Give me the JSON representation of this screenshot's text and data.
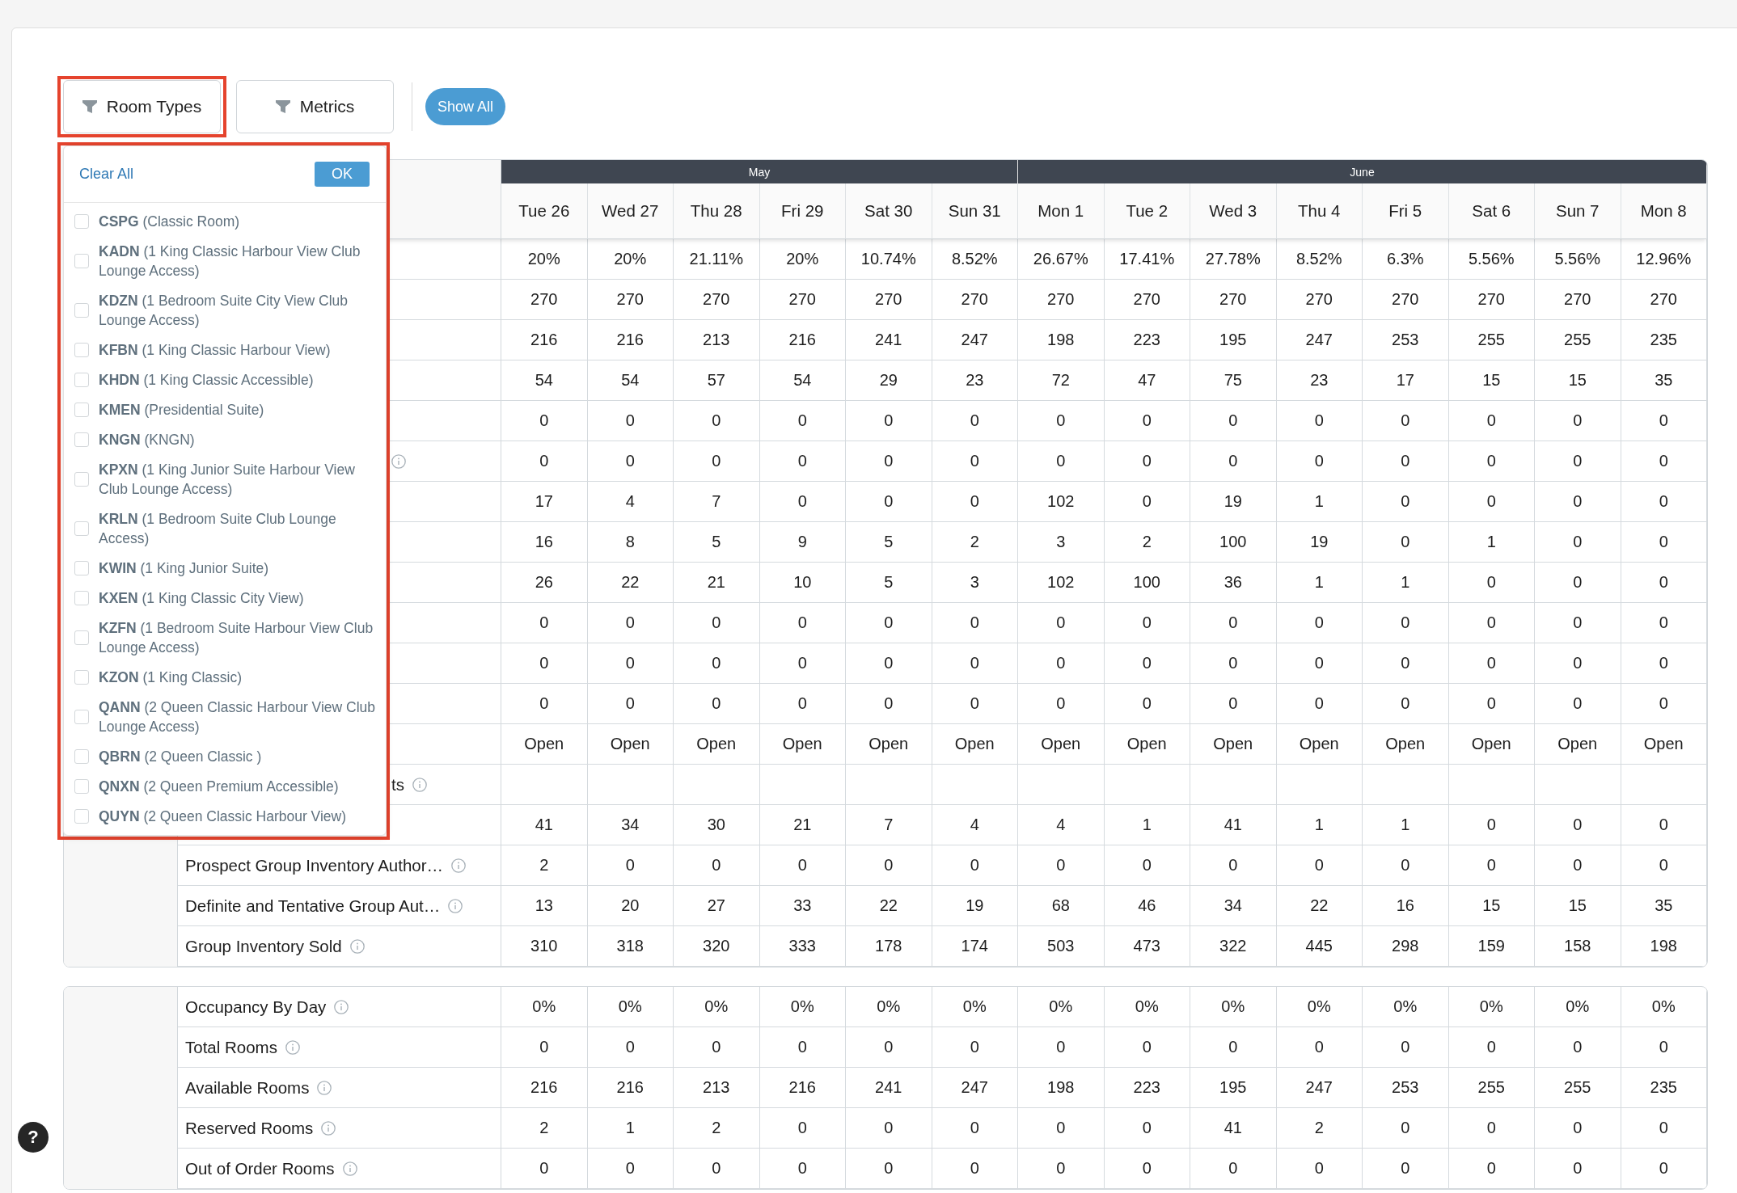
{
  "toolbar": {
    "filters": [
      {
        "label": "Room Types",
        "highlighted": true,
        "menu": {
          "clear_label": "Clear All",
          "ok_label": "OK",
          "options": [
            {
              "label": "**CSPG** (Classic Room)",
              "checked": false
            },
            {
              "label": "**KADN** (1 King Classic Harbour View Club Lounge Access)",
              "checked": false
            },
            {
              "label": "**KDZN** (1 Bedroom Suite City View Club Lounge Access)",
              "checked": false
            },
            {
              "label": "**KFBN** (1 King Classic Harbour View)",
              "checked": false
            },
            {
              "label": "**KHDN** (1 King Classic Accessible)",
              "checked": false
            },
            {
              "label": "**KMEN** (Presidential Suite)",
              "checked": false
            },
            {
              "label": "**KNGN** (KNGN)",
              "checked": false
            },
            {
              "label": "**KPXN** (1 King Junior Suite Harbour View Club Lounge Access)",
              "checked": false
            },
            {
              "label": "**KRLN** (1 Bedroom Suite Club Lounge Access)",
              "checked": false
            },
            {
              "label": "**KWIN** (1 King Junior Suite)",
              "checked": false
            },
            {
              "label": "**KXEN** (1 King Classic City View)",
              "checked": false
            },
            {
              "label": "**KZFN** (1 Bedroom Suite Harbour View Club Lounge Access)",
              "checked": false
            },
            {
              "label": "**KZON** (1 King Classic)",
              "checked": false
            },
            {
              "label": "**QANN** (2 Queen Classic Harbour View Club Lounge Access)",
              "checked": false
            },
            {
              "label": "**QBRN** (2 Queen Classic )",
              "checked": false
            },
            {
              "label": "**QNXN** (2 Queen Premium Accessible)",
              "checked": false
            },
            {
              "label": "**QUYN** (2 Queen Classic Harbour View)",
              "checked": false
            }
          ]
        }
      },
      {
        "label": "Metrics",
        "highlighted": false
      }
    ],
    "show_all_label": "Show All"
  },
  "table": {
    "months": [
      {
        "label": "May",
        "days": [
          "Tue 26",
          "Wed 27",
          "Thu 28",
          "Fri 29",
          "Sat 30",
          "Sun 31"
        ]
      },
      {
        "label": "June",
        "days": [
          "Mon 1",
          "Tue 2",
          "Wed 3",
          "Thu 4",
          "Fri 5",
          "Sat 6",
          "Sun 7",
          "Mon 8"
        ]
      }
    ],
    "sections": [
      {
        "rows": [
          {
            "values": [
              "20%",
              "20%",
              "21.11%",
              "20%",
              "10.74%",
              "8.52%",
              "26.67%",
              "17.41%",
              "27.78%",
              "8.52%",
              "6.3%",
              "5.56%",
              "5.56%",
              "12.96%"
            ]
          },
          {
            "values": [
              "270",
              "270",
              "270",
              "270",
              "270",
              "270",
              "270",
              "270",
              "270",
              "270",
              "270",
              "270",
              "270",
              "270"
            ]
          },
          {
            "values": [
              "216",
              "216",
              "213",
              "216",
              "241",
              "247",
              "198",
              "223",
              "195",
              "247",
              "253",
              "255",
              "255",
              "235"
            ]
          },
          {
            "values": [
              "54",
              "54",
              "57",
              "54",
              "29",
              "23",
              "72",
              "47",
              "75",
              "23",
              "17",
              "15",
              "15",
              "35"
            ]
          },
          {
            "values": [
              "0",
              "0",
              "0",
              "0",
              "0",
              "0",
              "0",
              "0",
              "0",
              "0",
              "0",
              "0",
              "0",
              "0"
            ]
          },
          {
            "info": true,
            "values": [
              "0",
              "0",
              "0",
              "0",
              "0",
              "0",
              "0",
              "0",
              "0",
              "0",
              "0",
              "0",
              "0",
              "0"
            ]
          },
          {
            "values": [
              "17",
              "4",
              "7",
              "0",
              "0",
              "0",
              "102",
              "0",
              "19",
              "1",
              "0",
              "0",
              "0",
              "0"
            ]
          },
          {
            "values": [
              "16",
              "8",
              "5",
              "9",
              "5",
              "2",
              "3",
              "2",
              "100",
              "19",
              "0",
              "1",
              "0",
              "0"
            ]
          },
          {
            "values": [
              "26",
              "22",
              "21",
              "10",
              "5",
              "3",
              "102",
              "100",
              "36",
              "1",
              "1",
              "0",
              "0",
              "0"
            ]
          },
          {
            "values": [
              "0",
              "0",
              "0",
              "0",
              "0",
              "0",
              "0",
              "0",
              "0",
              "0",
              "0",
              "0",
              "0",
              "0"
            ]
          },
          {
            "values": [
              "0",
              "0",
              "0",
              "0",
              "0",
              "0",
              "0",
              "0",
              "0",
              "0",
              "0",
              "0",
              "0",
              "0"
            ]
          },
          {
            "values": [
              "0",
              "0",
              "0",
              "0",
              "0",
              "0",
              "0",
              "0",
              "0",
              "0",
              "0",
              "0",
              "0",
              "0"
            ]
          },
          {
            "values": [
              "Open",
              "Open",
              "Open",
              "Open",
              "Open",
              "Open",
              "Open",
              "Open",
              "Open",
              "Open",
              "Open",
              "Open",
              "Open",
              "Open"
            ]
          },
          {
            "label": "ts",
            "info": true
          },
          {
            "values": [
              "41",
              "34",
              "30",
              "21",
              "7",
              "4",
              "4",
              "1",
              "41",
              "1",
              "1",
              "0",
              "0",
              "0"
            ]
          },
          {
            "label": "Prospect Group Inventory Author…",
            "info": true,
            "values": [
              "2",
              "0",
              "0",
              "0",
              "0",
              "0",
              "0",
              "0",
              "0",
              "0",
              "0",
              "0",
              "0",
              "0"
            ]
          },
          {
            "label": "Definite and Tentative Group Aut…",
            "info": true,
            "values": [
              "13",
              "20",
              "27",
              "33",
              "22",
              "19",
              "68",
              "46",
              "34",
              "22",
              "16",
              "15",
              "15",
              "35"
            ]
          },
          {
            "label": "Group Inventory Sold",
            "info": true,
            "values": [
              "310",
              "318",
              "320",
              "333",
              "178",
              "174",
              "503",
              "473",
              "322",
              "445",
              "298",
              "159",
              "158",
              "198"
            ]
          }
        ]
      },
      {
        "rows": [
          {
            "label": "Occupancy By Day",
            "info": true,
            "values": [
              "0%",
              "0%",
              "0%",
              "0%",
              "0%",
              "0%",
              "0%",
              "0%",
              "0%",
              "0%",
              "0%",
              "0%",
              "0%",
              "0%"
            ]
          },
          {
            "label": "Total Rooms",
            "info": true,
            "values": [
              "0",
              "0",
              "0",
              "0",
              "0",
              "0",
              "0",
              "0",
              "0",
              "0",
              "0",
              "0",
              "0",
              "0"
            ]
          },
          {
            "label": "Available Rooms",
            "info": true,
            "values": [
              "216",
              "216",
              "213",
              "216",
              "241",
              "247",
              "198",
              "223",
              "195",
              "247",
              "253",
              "255",
              "255",
              "235"
            ]
          },
          {
            "label": "Reserved Rooms",
            "info": true,
            "values": [
              "2",
              "1",
              "2",
              "0",
              "0",
              "0",
              "0",
              "0",
              "41",
              "2",
              "0",
              "0",
              "0",
              "0"
            ]
          },
          {
            "label": "Out of Order Rooms",
            "info": true,
            "values": [
              "0",
              "0",
              "0",
              "0",
              "0",
              "0",
              "0",
              "0",
              "0",
              "0",
              "0",
              "0",
              "0",
              "0"
            ]
          }
        ]
      }
    ]
  },
  "help_button": "?"
}
